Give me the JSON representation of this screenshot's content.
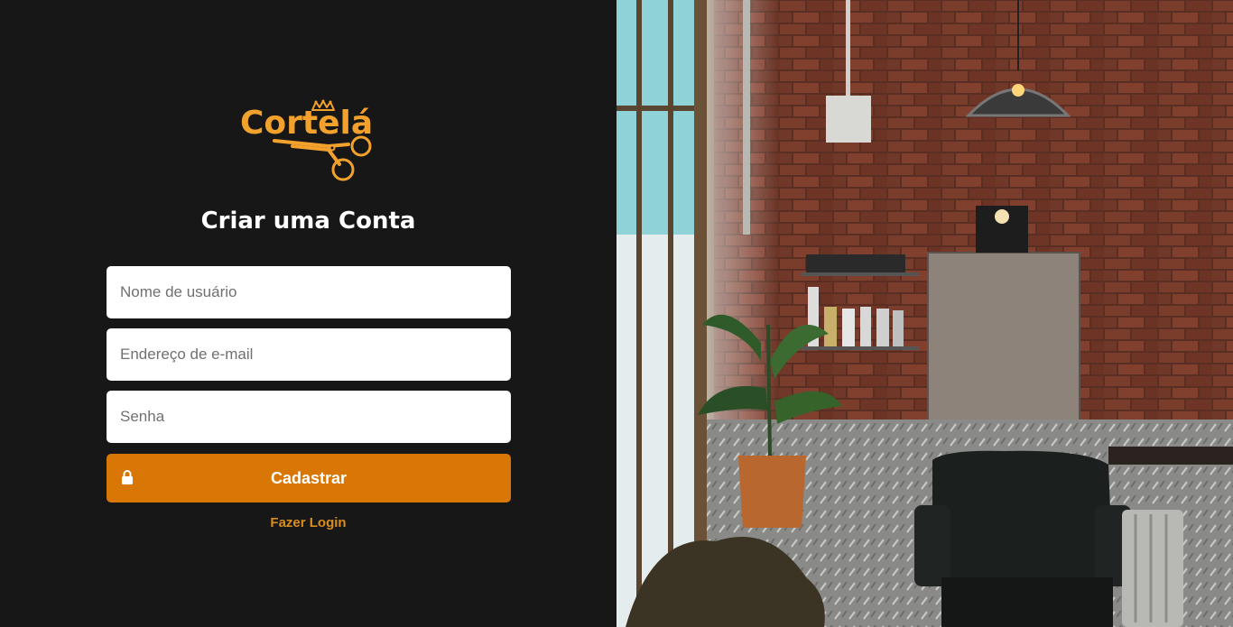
{
  "logo": {
    "text": "Cortelá"
  },
  "form": {
    "title": "Criar uma Conta",
    "username_placeholder": "Nome de usuário",
    "email_placeholder": "Endereço de e-mail",
    "password_placeholder": "Senha",
    "submit_label": "Cadastrar",
    "login_link": "Fazer Login"
  },
  "colors": {
    "background": "#171718",
    "accent": "#d97706",
    "logo": "#f2a12c",
    "link": "#d98d1a"
  },
  "icons": [
    "crown-icon",
    "scissors-icon",
    "lock-icon"
  ]
}
